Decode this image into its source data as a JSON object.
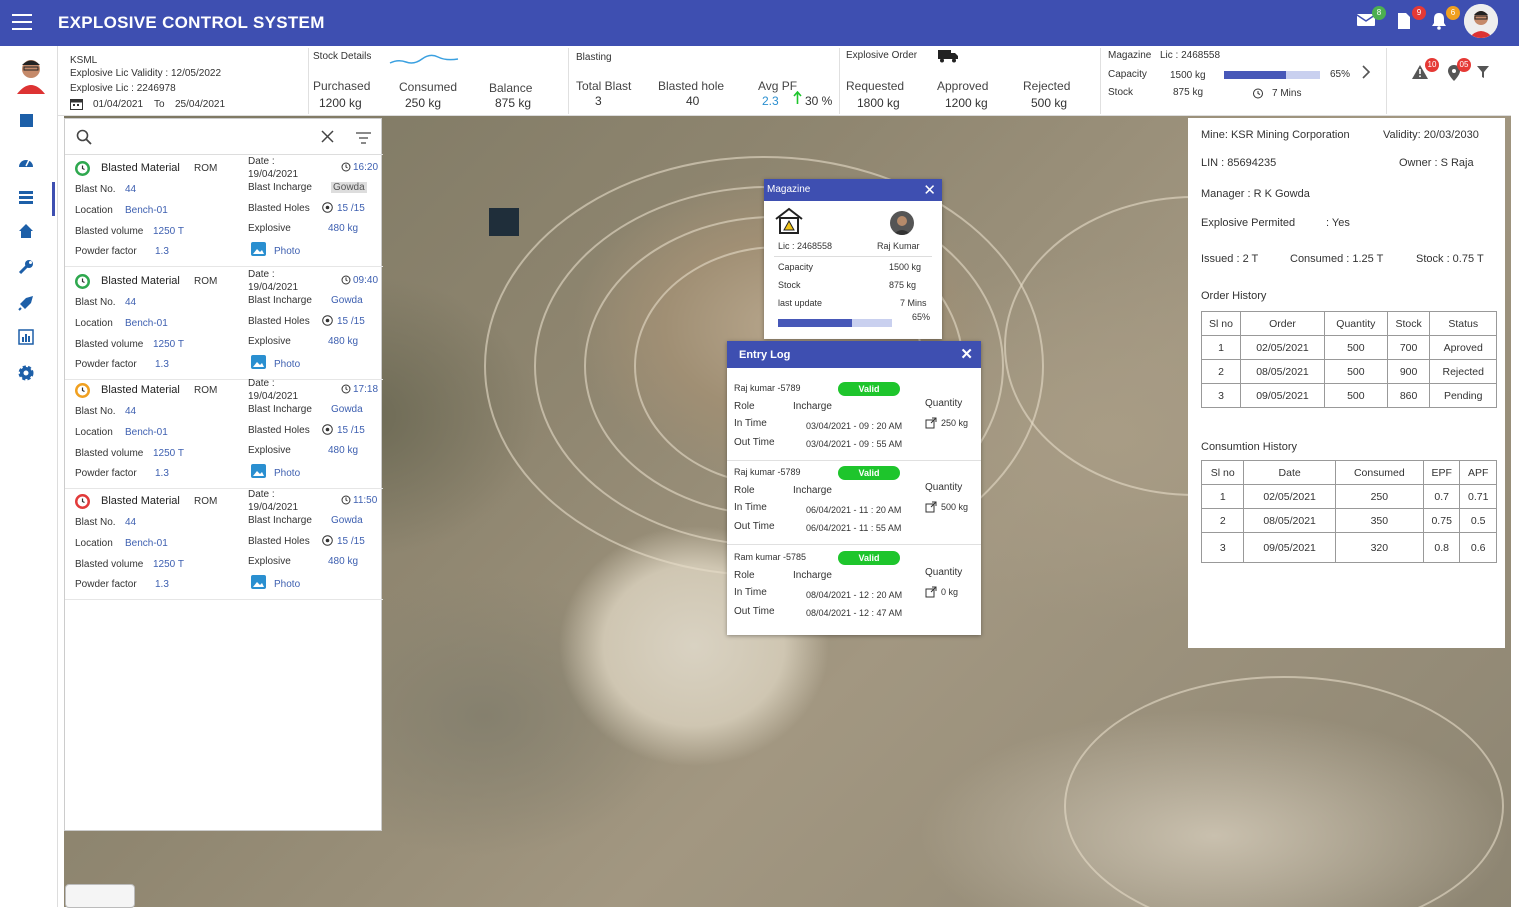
{
  "app": {
    "title": "EXPLOSIVE CONTROL SYSTEM",
    "badges": {
      "mail": "8",
      "docs": "9",
      "bell": "6"
    }
  },
  "company": {
    "name": "KSML",
    "lic_validity": "Explosive Lic Validity : 12/05/2022",
    "lic": "Explosive Lic : 2246978",
    "from": "01/04/2021",
    "to_label": "To",
    "to": "25/04/2021"
  },
  "stock": {
    "title": "Stock Details",
    "purchased_label": "Purchased",
    "purchased": "1200 kg",
    "consumed_label": "Consumed",
    "consumed": "250 kg",
    "balance_label": "Balance",
    "balance": "875 kg"
  },
  "blasting": {
    "title": "Blasting",
    "total_label": "Total Blast",
    "total": "3",
    "holes_label": "Blasted hole",
    "holes": "40",
    "pf_label": "Avg PF",
    "pf": "2.3",
    "pf_pct": "30 %"
  },
  "order": {
    "title": "Explosive Order",
    "req_label": "Requested",
    "req": "1800 kg",
    "app_label": "Approved",
    "app": "1200 kg",
    "rej_label": "Rejected",
    "rej": "500 kg"
  },
  "magazine_bar": {
    "title": "Magazine",
    "lic": "Lic : 2468558",
    "cap_label": "Capacity",
    "cap": "1500 kg",
    "stock_label": "Stock",
    "stock": "875 kg",
    "pct": "65%",
    "pct_value": 0.65,
    "mins": "7 Mins"
  },
  "alerts": {
    "warn": "10",
    "loc": "05"
  },
  "list": {
    "cards": [
      {
        "title": "Blasted Material",
        "rom": "ROM",
        "date_label": "Date :",
        "date": "19/04/2021",
        "time": "16:20",
        "status": "green",
        "blast_label": "Blast No.",
        "blast": "44",
        "incharge_label": "Blast Incharge",
        "incharge": "Gowda",
        "loc_label": "Location",
        "loc": "Bench-01",
        "holes_label": "Blasted Holes",
        "holes": "15 /15",
        "vol_label": "Blasted volume",
        "vol": "1250 T",
        "exp_label": "Explosive",
        "exp": "480 kg",
        "pf_label": "Powder factor",
        "pf": "1.3",
        "photo": "Photo"
      },
      {
        "title": "Blasted Material",
        "rom": "ROM",
        "date_label": "Date :",
        "date": "19/04/2021",
        "time": "09:40",
        "status": "green",
        "blast_label": "Blast No.",
        "blast": "44",
        "incharge_label": "Blast Incharge",
        "incharge": "Gowda",
        "loc_label": "Location",
        "loc": "Bench-01",
        "holes_label": "Blasted Holes",
        "holes": "15 /15",
        "vol_label": "Blasted volume",
        "vol": "1250 T",
        "exp_label": "Explosive",
        "exp": "480 kg",
        "pf_label": "Powder factor",
        "pf": "1.3",
        "photo": "Photo"
      },
      {
        "title": "Blasted Material",
        "rom": "ROM",
        "date_label": "Date :",
        "date": "19/04/2021",
        "time": "17:18",
        "status": "orange",
        "blast_label": "Blast No.",
        "blast": "44",
        "incharge_label": "Blast Incharge",
        "incharge": "Gowda",
        "loc_label": "Location",
        "loc": "Bench-01",
        "holes_label": "Blasted Holes",
        "holes": "15 /15",
        "vol_label": "Blasted volume",
        "vol": "1250 T",
        "exp_label": "Explosive",
        "exp": "480 kg",
        "pf_label": "Powder factor",
        "pf": "1.3",
        "photo": "Photo"
      },
      {
        "title": "Blasted Material",
        "rom": "ROM",
        "date_label": "Date :",
        "date": "19/04/2021",
        "time": "11:50",
        "status": "red",
        "blast_label": "Blast No.",
        "blast": "44",
        "incharge_label": "Blast Incharge",
        "incharge": "Gowda",
        "loc_label": "Location",
        "loc": "Bench-01",
        "holes_label": "Blasted Holes",
        "holes": "15 /15",
        "vol_label": "Blasted volume",
        "vol": "1250 T",
        "exp_label": "Explosive",
        "exp": "480 kg",
        "pf_label": "Powder factor",
        "pf": "1.3",
        "photo": "Photo"
      }
    ]
  },
  "magpopup": {
    "title": "Magazine",
    "lic": "Lic : 2468558",
    "person": "Raj Kumar",
    "cap_label": "Capacity",
    "cap": "1500 kg",
    "stock_label": "Stock",
    "stock": "875 kg",
    "upd_label": "last update",
    "upd": "7 Mins",
    "pct": "65%",
    "pct_value": 0.65
  },
  "entrylog": {
    "title": "Entry  Log",
    "entries": [
      {
        "name": "Raj kumar -5789",
        "status": "Valid",
        "role_label": "Role",
        "role": "Incharge",
        "in_label": "In Time",
        "in": "03/04/2021 - 09 : 20 AM",
        "out_label": "Out Time",
        "out": "03/04/2021 - 09 : 55 AM",
        "qty_label": "Quantity",
        "qty": "250 kg"
      },
      {
        "name": "Raj kumar -5789",
        "status": "Valid",
        "role_label": "Role",
        "role": "Incharge",
        "in_label": "In Time",
        "in": "06/04/2021 - 11 : 20 AM",
        "out_label": "Out Time",
        "out": "06/04/2021 - 11 : 55 AM",
        "qty_label": "Quantity",
        "qty": "500 kg"
      },
      {
        "name": "Ram kumar -5785",
        "status": "Valid",
        "role_label": "Role",
        "role": "Incharge",
        "in_label": "In Time",
        "in": "08/04/2021 - 12 : 20 AM",
        "out_label": "Out Time",
        "out": "08/04/2021 - 12 : 47 AM",
        "qty_label": "Quantity",
        "qty": "0 kg"
      }
    ]
  },
  "mine": {
    "name": "Mine: KSR Mining Corporation",
    "validity": "Validity: 20/03/2030",
    "lin": "LIN  : 85694235",
    "owner": "Owner : S Raja",
    "manager": "Manager : R K Gowda",
    "exp_label": "Explosive Permited",
    "exp": ": Yes",
    "issued": "Issued : 2 T",
    "consumed": "Consumed : 1.25 T",
    "stock": "Stock : 0.75 T"
  },
  "order_history": {
    "title": "Order History",
    "headers": [
      "Sl no",
      "Order",
      "Quantity",
      "Stock",
      "Status"
    ],
    "rows": [
      [
        "1",
        "02/05/2021",
        "500",
        "700",
        "Aproved"
      ],
      [
        "2",
        "08/05/2021",
        "500",
        "900",
        "Rejected"
      ],
      [
        "3",
        "09/05/2021",
        "500",
        "860",
        "Pending"
      ]
    ]
  },
  "consumption_history": {
    "title": "Consumtion  History",
    "headers": [
      "Sl no",
      "Date",
      "Consumed",
      "EPF",
      "APF"
    ],
    "rows": [
      [
        "1",
        "02/05/2021",
        "250",
        "0.7",
        "0.71"
      ],
      [
        "2",
        "08/05/2021",
        "350",
        "0.75",
        "0.5"
      ],
      [
        "3",
        "09/05/2021",
        "320",
        "0.8",
        "0.6"
      ]
    ]
  },
  "colors": {
    "primary": "#3e4fb1",
    "valid": "#1ec52c",
    "status_green": "#2fa84f",
    "status_orange": "#f0a020",
    "status_red": "#e23b3b"
  }
}
